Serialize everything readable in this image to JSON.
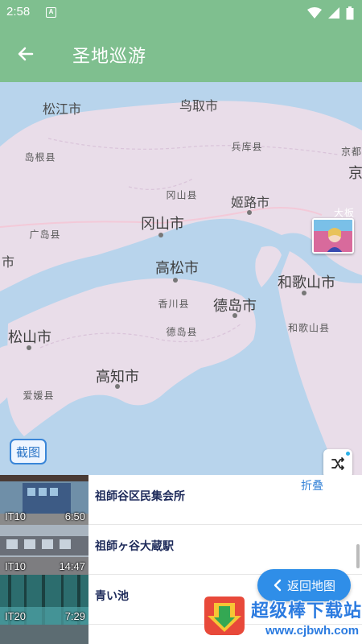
{
  "status_bar": {
    "time": "2:58",
    "app_badge": "A"
  },
  "toolbar": {
    "title": "圣地巡游"
  },
  "map": {
    "labels": [
      {
        "text": "松江市",
        "kind": "city"
      },
      {
        "text": "鸟取市",
        "kind": "city"
      },
      {
        "text": "岛根县",
        "kind": "pref"
      },
      {
        "text": "兵库县",
        "kind": "pref"
      },
      {
        "text": "京都",
        "kind": "pref"
      },
      {
        "text": "冈山县",
        "kind": "pref"
      },
      {
        "text": "姬路市",
        "kind": "city"
      },
      {
        "text": "广岛县",
        "kind": "pref"
      },
      {
        "text": "冈山市",
        "kind": "big"
      },
      {
        "text": "市",
        "kind": "city"
      },
      {
        "text": "高松市",
        "kind": "big"
      },
      {
        "text": "和歌山市",
        "kind": "big"
      },
      {
        "text": "香川县",
        "kind": "pref"
      },
      {
        "text": "德岛市",
        "kind": "big"
      },
      {
        "text": "松山市",
        "kind": "big"
      },
      {
        "text": "德岛县",
        "kind": "pref"
      },
      {
        "text": "和歌山县",
        "kind": "pref"
      },
      {
        "text": "高知市",
        "kind": "big"
      },
      {
        "text": "爱媛县",
        "kind": "pref"
      },
      {
        "text": "京",
        "kind": "big"
      },
      {
        "text": "大板",
        "kind": "pref"
      }
    ],
    "capture_label": "截图"
  },
  "list": {
    "collapse_label": "折叠",
    "items": [
      {
        "episode": "IT10",
        "timecode": "6:50",
        "name": "祖師谷区民集会所"
      },
      {
        "episode": "IT10",
        "timecode": "14:47",
        "name": "祖師ヶ谷大蔵駅"
      },
      {
        "episode": "IT20",
        "timecode": "7:29",
        "name": "青い池"
      },
      {
        "episode": "",
        "timecode": "",
        "name": ""
      }
    ]
  },
  "return_button": {
    "label": "返回地图"
  },
  "watermark": {
    "title": "超级棒下载站",
    "url": "www.cjbwh.com"
  },
  "colors": {
    "toolbar": "#7fbf8f",
    "accent": "#2f8ee8",
    "land": "#e9dde9",
    "water": "#b8d4ec"
  }
}
